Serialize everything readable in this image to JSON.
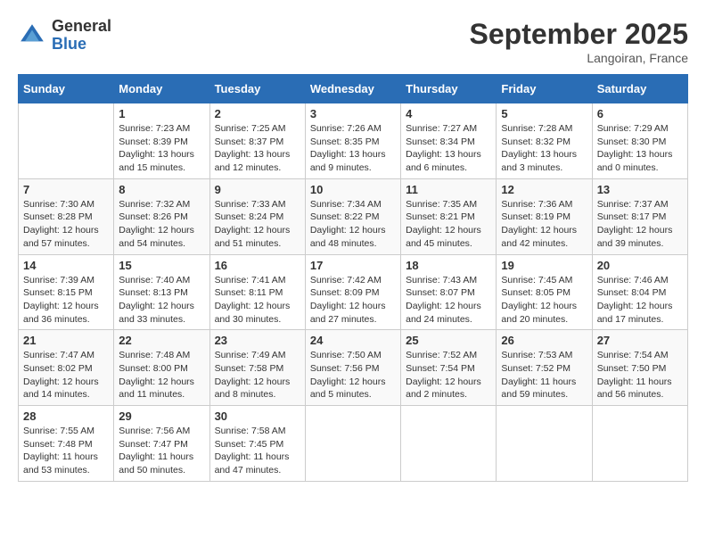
{
  "logo": {
    "general": "General",
    "blue": "Blue"
  },
  "title": "September 2025",
  "location": "Langoiran, France",
  "days_header": [
    "Sunday",
    "Monday",
    "Tuesday",
    "Wednesday",
    "Thursday",
    "Friday",
    "Saturday"
  ],
  "weeks": [
    [
      {
        "day": "",
        "content": ""
      },
      {
        "day": "1",
        "content": "Sunrise: 7:23 AM\nSunset: 8:39 PM\nDaylight: 13 hours\nand 15 minutes."
      },
      {
        "day": "2",
        "content": "Sunrise: 7:25 AM\nSunset: 8:37 PM\nDaylight: 13 hours\nand 12 minutes."
      },
      {
        "day": "3",
        "content": "Sunrise: 7:26 AM\nSunset: 8:35 PM\nDaylight: 13 hours\nand 9 minutes."
      },
      {
        "day": "4",
        "content": "Sunrise: 7:27 AM\nSunset: 8:34 PM\nDaylight: 13 hours\nand 6 minutes."
      },
      {
        "day": "5",
        "content": "Sunrise: 7:28 AM\nSunset: 8:32 PM\nDaylight: 13 hours\nand 3 minutes."
      },
      {
        "day": "6",
        "content": "Sunrise: 7:29 AM\nSunset: 8:30 PM\nDaylight: 13 hours\nand 0 minutes."
      }
    ],
    [
      {
        "day": "7",
        "content": "Sunrise: 7:30 AM\nSunset: 8:28 PM\nDaylight: 12 hours\nand 57 minutes."
      },
      {
        "day": "8",
        "content": "Sunrise: 7:32 AM\nSunset: 8:26 PM\nDaylight: 12 hours\nand 54 minutes."
      },
      {
        "day": "9",
        "content": "Sunrise: 7:33 AM\nSunset: 8:24 PM\nDaylight: 12 hours\nand 51 minutes."
      },
      {
        "day": "10",
        "content": "Sunrise: 7:34 AM\nSunset: 8:22 PM\nDaylight: 12 hours\nand 48 minutes."
      },
      {
        "day": "11",
        "content": "Sunrise: 7:35 AM\nSunset: 8:21 PM\nDaylight: 12 hours\nand 45 minutes."
      },
      {
        "day": "12",
        "content": "Sunrise: 7:36 AM\nSunset: 8:19 PM\nDaylight: 12 hours\nand 42 minutes."
      },
      {
        "day": "13",
        "content": "Sunrise: 7:37 AM\nSunset: 8:17 PM\nDaylight: 12 hours\nand 39 minutes."
      }
    ],
    [
      {
        "day": "14",
        "content": "Sunrise: 7:39 AM\nSunset: 8:15 PM\nDaylight: 12 hours\nand 36 minutes."
      },
      {
        "day": "15",
        "content": "Sunrise: 7:40 AM\nSunset: 8:13 PM\nDaylight: 12 hours\nand 33 minutes."
      },
      {
        "day": "16",
        "content": "Sunrise: 7:41 AM\nSunset: 8:11 PM\nDaylight: 12 hours\nand 30 minutes."
      },
      {
        "day": "17",
        "content": "Sunrise: 7:42 AM\nSunset: 8:09 PM\nDaylight: 12 hours\nand 27 minutes."
      },
      {
        "day": "18",
        "content": "Sunrise: 7:43 AM\nSunset: 8:07 PM\nDaylight: 12 hours\nand 24 minutes."
      },
      {
        "day": "19",
        "content": "Sunrise: 7:45 AM\nSunset: 8:05 PM\nDaylight: 12 hours\nand 20 minutes."
      },
      {
        "day": "20",
        "content": "Sunrise: 7:46 AM\nSunset: 8:04 PM\nDaylight: 12 hours\nand 17 minutes."
      }
    ],
    [
      {
        "day": "21",
        "content": "Sunrise: 7:47 AM\nSunset: 8:02 PM\nDaylight: 12 hours\nand 14 minutes."
      },
      {
        "day": "22",
        "content": "Sunrise: 7:48 AM\nSunset: 8:00 PM\nDaylight: 12 hours\nand 11 minutes."
      },
      {
        "day": "23",
        "content": "Sunrise: 7:49 AM\nSunset: 7:58 PM\nDaylight: 12 hours\nand 8 minutes."
      },
      {
        "day": "24",
        "content": "Sunrise: 7:50 AM\nSunset: 7:56 PM\nDaylight: 12 hours\nand 5 minutes."
      },
      {
        "day": "25",
        "content": "Sunrise: 7:52 AM\nSunset: 7:54 PM\nDaylight: 12 hours\nand 2 minutes."
      },
      {
        "day": "26",
        "content": "Sunrise: 7:53 AM\nSunset: 7:52 PM\nDaylight: 11 hours\nand 59 minutes."
      },
      {
        "day": "27",
        "content": "Sunrise: 7:54 AM\nSunset: 7:50 PM\nDaylight: 11 hours\nand 56 minutes."
      }
    ],
    [
      {
        "day": "28",
        "content": "Sunrise: 7:55 AM\nSunset: 7:48 PM\nDaylight: 11 hours\nand 53 minutes."
      },
      {
        "day": "29",
        "content": "Sunrise: 7:56 AM\nSunset: 7:47 PM\nDaylight: 11 hours\nand 50 minutes."
      },
      {
        "day": "30",
        "content": "Sunrise: 7:58 AM\nSunset: 7:45 PM\nDaylight: 11 hours\nand 47 minutes."
      },
      {
        "day": "",
        "content": ""
      },
      {
        "day": "",
        "content": ""
      },
      {
        "day": "",
        "content": ""
      },
      {
        "day": "",
        "content": ""
      }
    ]
  ]
}
